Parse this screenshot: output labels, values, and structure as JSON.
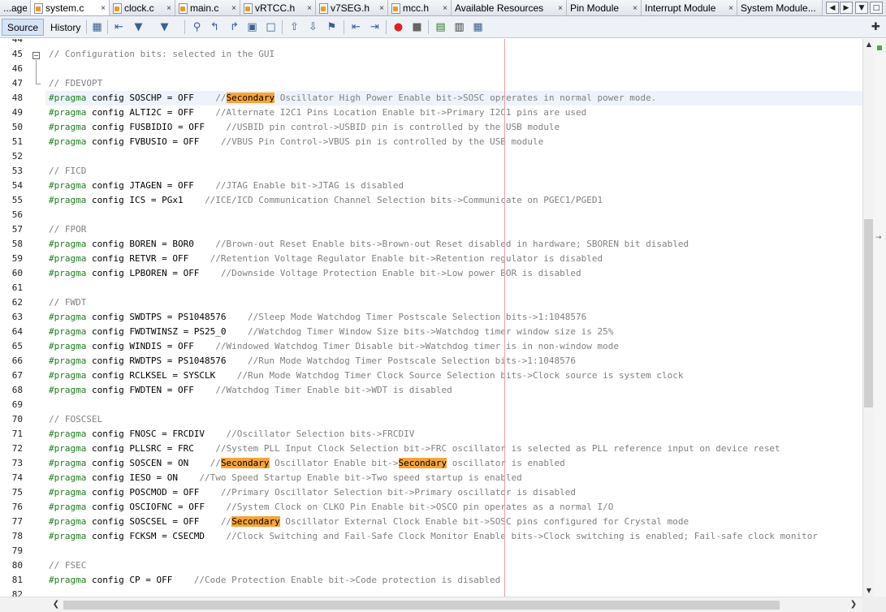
{
  "tabs": [
    {
      "label": "...age",
      "closable": false,
      "has_icon": false
    },
    {
      "label": "system.c",
      "closable": true,
      "has_icon": true,
      "active": true
    },
    {
      "label": "clock.c",
      "closable": true,
      "has_icon": true
    },
    {
      "label": "main.c",
      "closable": true,
      "has_icon": true
    },
    {
      "label": "vRTCC.h",
      "closable": true,
      "has_icon": true
    },
    {
      "label": "v7SEG.h",
      "closable": true,
      "has_icon": true
    },
    {
      "label": "mcc.h",
      "closable": true,
      "has_icon": true
    },
    {
      "label": "Available Resources",
      "closable": true,
      "has_icon": false
    },
    {
      "label": "Pin Module",
      "closable": true,
      "has_icon": false
    },
    {
      "label": "Interrupt Module",
      "closable": true,
      "has_icon": false
    },
    {
      "label": "System Module...",
      "closable": false,
      "has_icon": false
    }
  ],
  "tab_close_glyph": "×",
  "toolbar": {
    "source_label": "Source",
    "history_label": "History",
    "icons": [
      "last-edit-icon",
      "back-icon",
      "forward-icon",
      "find-icon",
      "find-previous-icon",
      "find-next-icon",
      "toggle-highlight-icon",
      "toggle-rectangular-icon",
      "previous-bookmark-icon",
      "next-bookmark-icon",
      "toggle-bookmark-icon",
      "shift-left-icon",
      "shift-right-icon",
      "start-macro-icon",
      "stop-macro-icon",
      "comment-icon",
      "uncomment-icon",
      "diff-icon"
    ]
  },
  "editor": {
    "highlight_word": "Secondary",
    "current_line": 48,
    "lines": [
      {
        "n": "44",
        "code": ""
      },
      {
        "n": "45",
        "code": "// Configuration bits: selected in the GUI"
      },
      {
        "n": "46",
        "code": ""
      },
      {
        "n": "47",
        "code": "// FDEVOPT"
      },
      {
        "n": "48",
        "code": "#pragma config SOSCHP = OFF    //Secondary Oscillator High Power Enable bit->SOSC oprerates in normal power mode."
      },
      {
        "n": "49",
        "code": "#pragma config ALTI2C = OFF    //Alternate I2C1 Pins Location Enable bit->Primary I2C1 pins are used"
      },
      {
        "n": "50",
        "code": "#pragma config FUSBIDIO = OFF    //USBID pin control->USBID pin is controlled by the USB module"
      },
      {
        "n": "51",
        "code": "#pragma config FVBUSIO = OFF    //VBUS Pin Control->VBUS pin is controlled by the USB module"
      },
      {
        "n": "52",
        "code": ""
      },
      {
        "n": "53",
        "code": "// FICD"
      },
      {
        "n": "54",
        "code": "#pragma config JTAGEN = OFF    //JTAG Enable bit->JTAG is disabled"
      },
      {
        "n": "55",
        "code": "#pragma config ICS = PGx1    //ICE/ICD Communication Channel Selection bits->Communicate on PGEC1/PGED1"
      },
      {
        "n": "56",
        "code": ""
      },
      {
        "n": "57",
        "code": "// FPOR"
      },
      {
        "n": "58",
        "code": "#pragma config BOREN = BOR0    //Brown-out Reset Enable bits->Brown-out Reset disabled in hardware; SBOREN bit disabled"
      },
      {
        "n": "59",
        "code": "#pragma config RETVR = OFF    //Retention Voltage Regulator Enable bit->Retention regulator is disabled"
      },
      {
        "n": "60",
        "code": "#pragma config LPBOREN = OFF    //Downside Voltage Protection Enable bit->Low power BOR is disabled"
      },
      {
        "n": "61",
        "code": ""
      },
      {
        "n": "62",
        "code": "// FWDT"
      },
      {
        "n": "63",
        "code": "#pragma config SWDTPS = PS1048576    //Sleep Mode Watchdog Timer Postscale Selection bits->1:1048576"
      },
      {
        "n": "64",
        "code": "#pragma config FWDTWINSZ = PS25_0    //Watchdog Timer Window Size bits->Watchdog timer window size is 25%"
      },
      {
        "n": "65",
        "code": "#pragma config WINDIS = OFF    //Windowed Watchdog Timer Disable bit->Watchdog timer is in non-window mode"
      },
      {
        "n": "66",
        "code": "#pragma config RWDTPS = PS1048576    //Run Mode Watchdog Timer Postscale Selection bits->1:1048576"
      },
      {
        "n": "67",
        "code": "#pragma config RCLKSEL = SYSCLK    //Run Mode Watchdog Timer Clock Source Selection bits->Clock source is system clock"
      },
      {
        "n": "68",
        "code": "#pragma config FWDTEN = OFF    //Watchdog Timer Enable bit->WDT is disabled"
      },
      {
        "n": "69",
        "code": ""
      },
      {
        "n": "70",
        "code": "// FOSCSEL"
      },
      {
        "n": "71",
        "code": "#pragma config FNOSC = FRCDIV    //Oscillator Selection bits->FRCDIV"
      },
      {
        "n": "72",
        "code": "#pragma config PLLSRC = FRC    //System PLL Input Clock Selection bit->FRC oscillator is selected as PLL reference input on device reset"
      },
      {
        "n": "73",
        "code": "#pragma config SOSCEN = ON    //Secondary Oscillator Enable bit->Secondary oscillator is enabled"
      },
      {
        "n": "74",
        "code": "#pragma config IESO = ON    //Two Speed Startup Enable bit->Two speed startup is enabled"
      },
      {
        "n": "75",
        "code": "#pragma config POSCMOD = OFF    //Primary Oscillator Selection bit->Primary oscillator is disabled"
      },
      {
        "n": "76",
        "code": "#pragma config OSCIOFNC = OFF    //System Clock on CLKO Pin Enable bit->OSCO pin operates as a normal I/O"
      },
      {
        "n": "77",
        "code": "#pragma config SOSCSEL = OFF    //Secondary Oscillator External Clock Enable bit->SOSC pins configured for Crystal mode"
      },
      {
        "n": "78",
        "code": "#pragma config FCKSM = CSECMD    //Clock Switching and Fail-Safe Clock Monitor Enable bits->Clock switching is enabled; Fail-safe clock monitor"
      },
      {
        "n": "79",
        "code": ""
      },
      {
        "n": "80",
        "code": "// FSEC"
      },
      {
        "n": "81",
        "code": "#pragma config CP = OFF    //Code Protection Enable bit->Code protection is disabled"
      },
      {
        "n": "82",
        "code": ""
      }
    ]
  },
  "colors": {
    "keyword": "#1c7d1c",
    "comment": "#808080",
    "search_match": "#f7a43a",
    "current_line": "#eef3fb",
    "right_margin": "#e7a0a0"
  }
}
